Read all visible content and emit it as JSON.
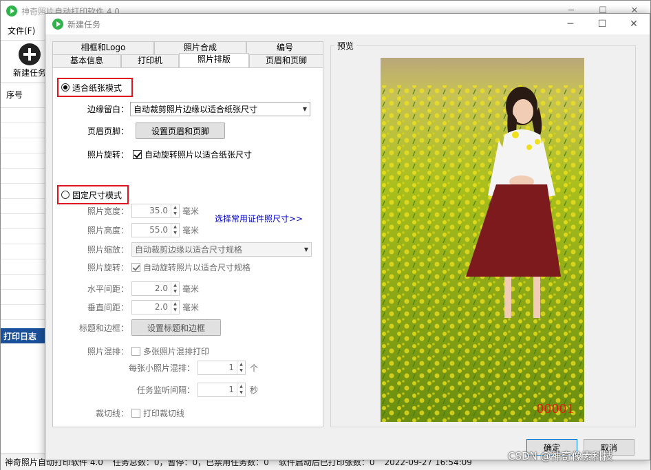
{
  "main_window": {
    "title": "神奇照片自动打印软件 4.0",
    "menu_file": "文件(F)",
    "new_task_label": "新建任务",
    "column_seq": "序号",
    "log_title": "打印日志",
    "status_items": [
      "神奇照片自动打印软件 4.0",
      "任务总数：0，暂停：0，已禁用任务数：0",
      "软件启动后已打印张数：0",
      "2022-09-27 16:54:09"
    ]
  },
  "dialog": {
    "title": "新建任务",
    "tabs": {
      "frame_logo": "相框和Logo",
      "photo_compose": "照片合成",
      "numbering": "编号",
      "basic_info": "基本信息",
      "printer": "打印机",
      "photo_layout": "照片排版",
      "header_footer": "页眉和页脚"
    },
    "fit_mode": {
      "label": "适合纸张模式",
      "margin_label": "边缘留白：",
      "margin_value": "自动裁剪照片边缘以适合纸张尺寸",
      "header_label": "页眉页脚：",
      "header_button": "设置页眉和页脚",
      "rotate_label": "照片旋转：",
      "rotate_check": "自动旋转照片以适合纸张尺寸"
    },
    "fixed_mode": {
      "label": "固定尺寸模式",
      "width_label": "照片宽度：",
      "width_value": "35.0",
      "height_label": "照片高度：",
      "height_value": "55.0",
      "unit_mm": "毫米",
      "id_link": "选择常用证件照尺寸>>",
      "scale_label": "照片缩放：",
      "scale_value": "自动裁剪边缘以适合尺寸规格",
      "rotate_label": "照片旋转：",
      "rotate_check": "自动旋转照片以适合尺寸规格",
      "hspace_label": "水平间距：",
      "hspace_value": "2.0",
      "vspace_label": "垂直间距：",
      "vspace_value": "2.0",
      "title_border_label": "标题和边框：",
      "title_border_button": "设置标题和边框",
      "mix_label": "照片混排：",
      "mix_check": "多张照片混排打印",
      "per_small_label": "每张小照片混排：",
      "per_small_value": "1",
      "unit_count": "个",
      "monitor_label": "任务监听间隔：",
      "monitor_value": "1",
      "unit_sec": "秒",
      "cut_label": "裁切线：",
      "cut_check": "打印裁切线"
    },
    "preview_label": "预览",
    "photo_number": "00001",
    "ok_button": "确定",
    "cancel_button": "取消"
  },
  "watermark": "CSDN @神奇像素科技"
}
